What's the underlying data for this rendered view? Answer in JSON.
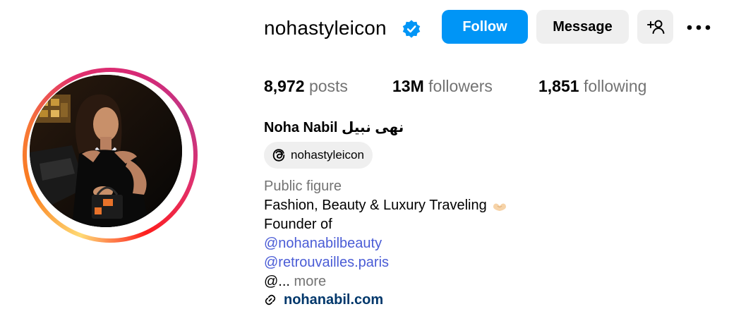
{
  "profile": {
    "username": "nohastyleicon",
    "verified": true,
    "full_name": "Noha Nabil نهى نبيل",
    "threads_handle": "nohastyleicon",
    "category": "Public figure",
    "bio": {
      "line1": "Fashion, Beauty & Luxury Traveling",
      "line2": "Founder of",
      "mention1": "@nohanabilbeauty",
      "mention2": "@retrouvailles.paris",
      "truncated_prefix": "@...",
      "more_label": "more"
    },
    "external_link": "nohanabil.com"
  },
  "actions": {
    "follow_label": "Follow",
    "message_label": "Message"
  },
  "stats": {
    "posts_count": "8,972",
    "posts_label": "posts",
    "followers_count": "13M",
    "followers_label": "followers",
    "following_count": "1,851",
    "following_label": "following"
  },
  "icons": {
    "verified": "verified-badge-icon",
    "add_user": "add-user-icon",
    "more": "more-options-icon",
    "threads": "threads-icon",
    "link": "link-icon",
    "bio_emoji": "heart-hands-emoji-icon"
  },
  "colors": {
    "primary_button": "#0095f6",
    "secondary_button": "#efefef",
    "secondary_text": "#737373",
    "mention": "#4a5cd6",
    "link": "#00376b",
    "verified": "#0095f6"
  }
}
